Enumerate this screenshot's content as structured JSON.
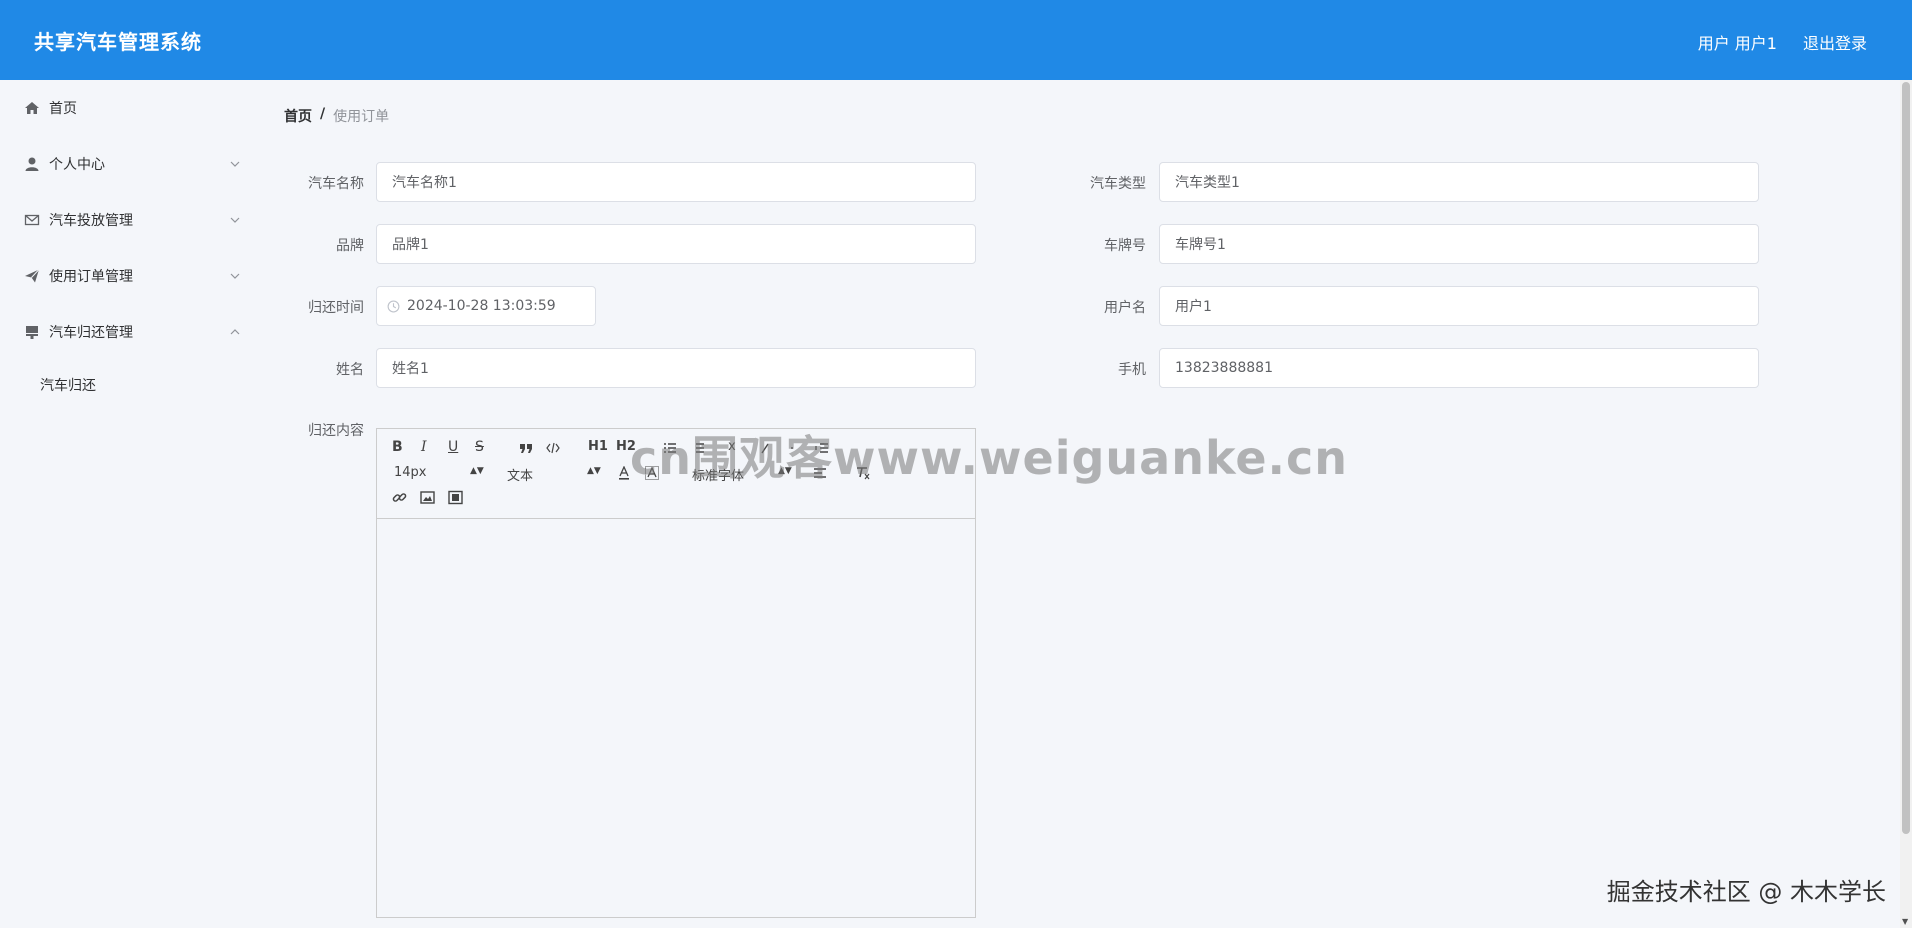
{
  "header": {
    "title": "共享汽车管理系统",
    "user_label": "用户 用户1",
    "logout_label": "退出登录"
  },
  "sidebar": {
    "items": [
      {
        "label": "首页",
        "icon": "home-icon"
      },
      {
        "label": "个人中心",
        "icon": "user-icon",
        "expandable": true,
        "expanded": false
      },
      {
        "label": "汽车投放管理",
        "icon": "mail-icon",
        "expandable": true,
        "expanded": false
      },
      {
        "label": "使用订单管理",
        "icon": "send-icon",
        "expandable": true,
        "expanded": false
      },
      {
        "label": "汽车归还管理",
        "icon": "stamp-icon",
        "expandable": true,
        "expanded": true
      }
    ],
    "submenu": {
      "label": "汽车归还"
    }
  },
  "breadcrumb": {
    "home": "首页",
    "separator": "/",
    "current": "使用订单"
  },
  "form": {
    "car_name": {
      "label": "汽车名称",
      "value": "汽车名称1"
    },
    "car_type": {
      "label": "汽车类型",
      "value": "汽车类型1"
    },
    "brand": {
      "label": "品牌",
      "value": "品牌1"
    },
    "plate": {
      "label": "车牌号",
      "value": "车牌号1"
    },
    "return_time": {
      "label": "归还时间",
      "value": "2024-10-28 13:03:59"
    },
    "username": {
      "label": "用户名",
      "value": "用户1"
    },
    "name": {
      "label": "姓名",
      "value": "姓名1"
    },
    "phone": {
      "label": "手机",
      "value": "13823888881"
    },
    "content": {
      "label": "归还内容"
    }
  },
  "editor": {
    "font_size": "14px",
    "header_select": "文本",
    "font_family": "标准字体",
    "h1": "H1",
    "h2": "H2"
  },
  "watermark": "cn围观客www.weiguanke.cn",
  "credit": "掘金技术社区 @ 木木学长",
  "colors": {
    "header_bg": "#2089e6",
    "page_bg": "#f4f6fa"
  }
}
